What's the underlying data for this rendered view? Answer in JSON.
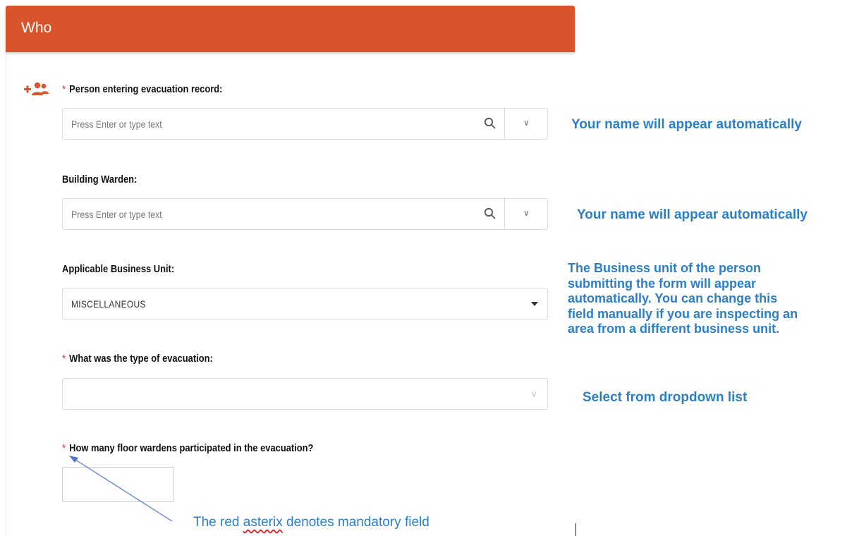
{
  "section": {
    "title": "Who"
  },
  "fields": [
    {
      "label": "Person entering evacuation record:",
      "required": true,
      "placeholder": "Press Enter or type text"
    },
    {
      "label": "Building Warden:",
      "required": false,
      "placeholder": "Press Enter or type text"
    },
    {
      "label": "Applicable Business Unit:",
      "required": false,
      "value": "MISCELLANEOUS"
    },
    {
      "label": "What was the type of evacuation:",
      "required": true,
      "value": ""
    },
    {
      "label": "How many floor wardens participated in the evacuation?",
      "required": true,
      "value": ""
    }
  ],
  "required_marker": "*",
  "annotations": {
    "name_auto_1": "Your name will appear automatically",
    "name_auto_2": "Your name will appear automatically",
    "business_unit": [
      "The Business unit of the person",
      "submitting the form will appear",
      "automatically. You can change this",
      "field manually if you are inspecting an",
      "area from a different business unit."
    ],
    "dropdown": "Select from dropdown list",
    "mandatory_pre": "The red ",
    "mandatory_word": "asterix",
    "mandatory_post": " denotes mandatory field"
  },
  "colors": {
    "header": "#d9542b",
    "note": "#2a7fc8",
    "required": "#dd3333",
    "arrow": "#6f8fd0"
  },
  "icons": {
    "header_icon": "add-group-icon",
    "search": "search-icon",
    "dropdown": "chevron-down-icon"
  }
}
